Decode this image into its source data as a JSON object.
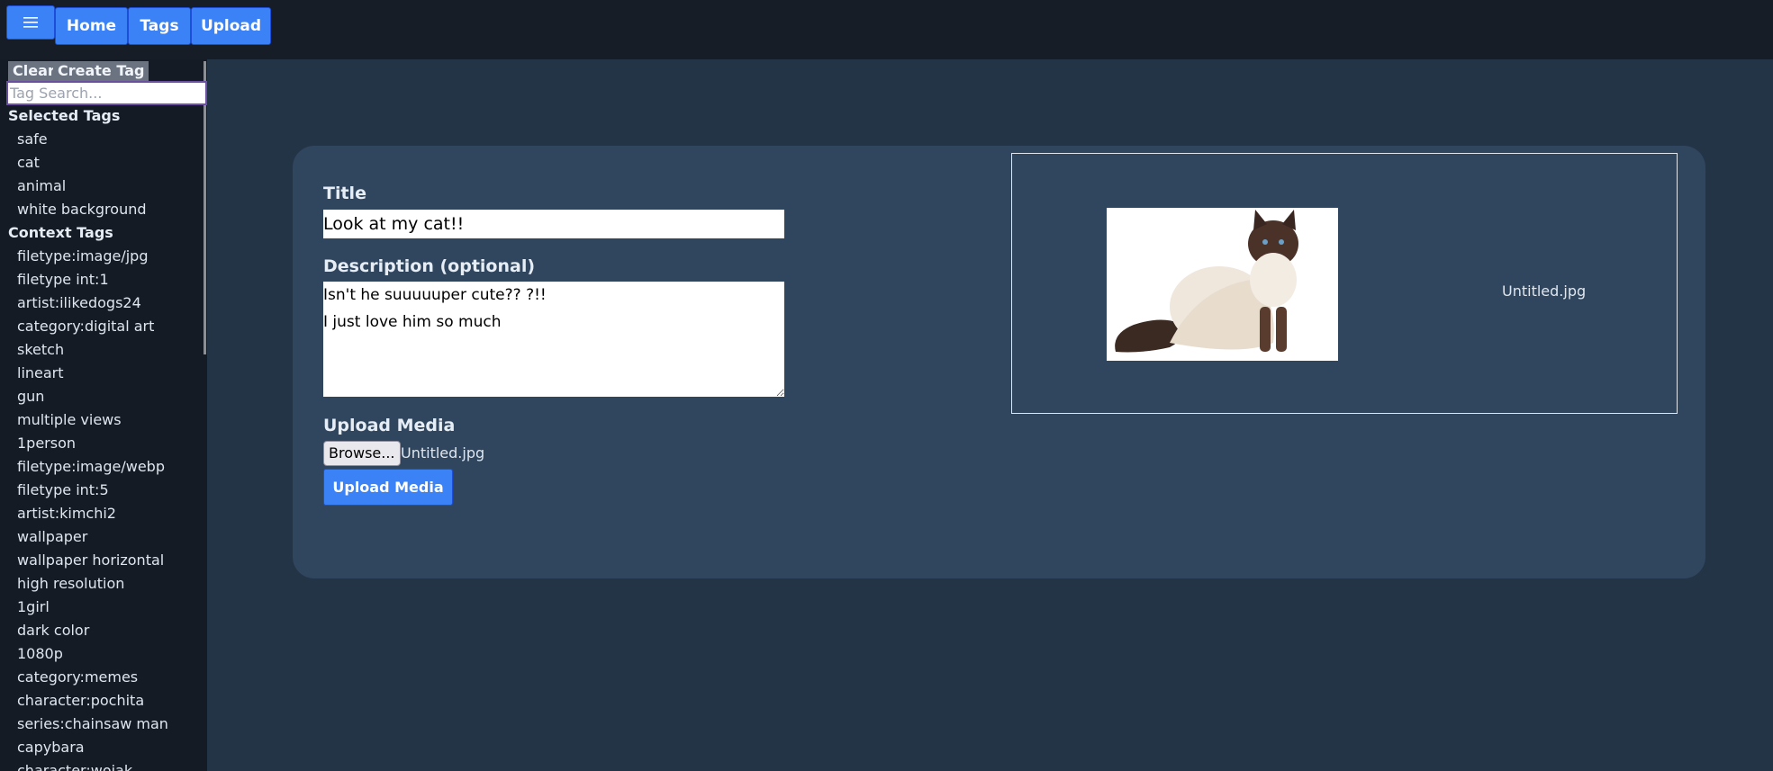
{
  "nav": {
    "menu_icon": "hamburger-icon",
    "home": "Home",
    "tags": "Tags",
    "upload": "Upload"
  },
  "sidebar": {
    "clear": "Clear",
    "create_tag": "Create Tag",
    "search_placeholder": "Tag Search...",
    "selected_heading": "Selected Tags",
    "selected_tags": [
      "safe",
      "cat",
      "animal",
      "white background"
    ],
    "context_heading": "Context Tags",
    "context_tags": [
      "filetype:image/jpg",
      "filetype int:1",
      "artist:ilikedogs24",
      "category:digital art",
      "sketch",
      "lineart",
      "gun",
      "multiple views",
      "1person",
      "filetype:image/webp",
      "filetype int:5",
      "artist:kimchi2",
      "wallpaper",
      "wallpaper horizontal",
      "high resolution",
      "1girl",
      "dark color",
      "1080p",
      "category:memes",
      "character:pochita",
      "series:chainsaw man",
      "capybara",
      "character:wojak"
    ]
  },
  "form": {
    "title_label": "Title",
    "title_value": "Look at my cat!!",
    "desc_label": "Description (optional)",
    "desc_value": "Isn't he suuuuuper cute?? ?!!\nI just love him so much",
    "media_label": "Upload Media",
    "browse": "Browse...",
    "file_name": "Untitled.jpg",
    "submit": "Upload Media"
  },
  "preview": {
    "file_name": "Untitled.jpg"
  }
}
